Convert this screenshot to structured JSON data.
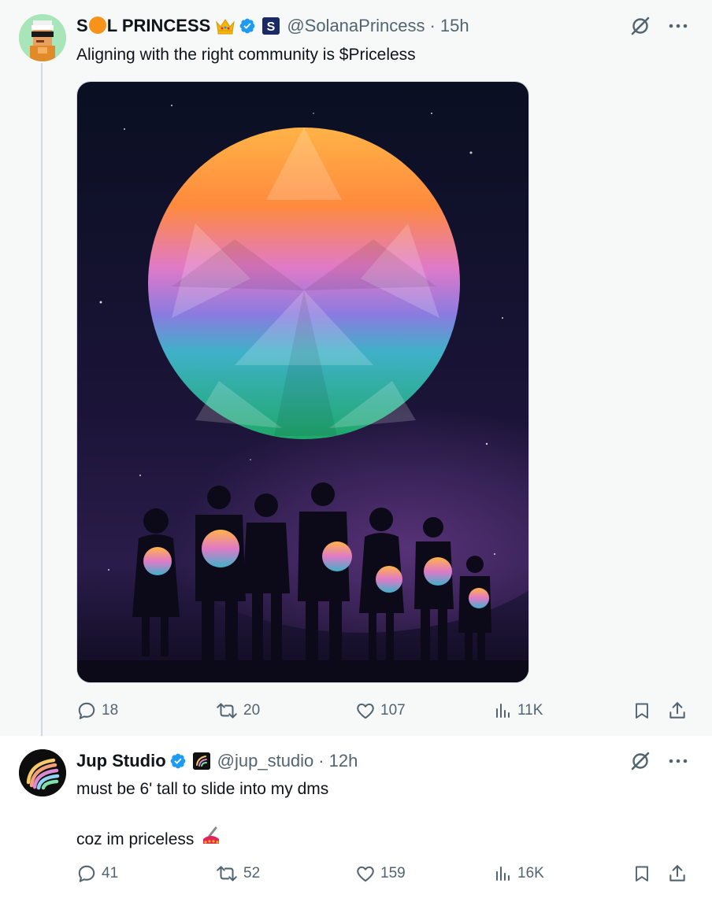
{
  "tweets": [
    {
      "display_name_prefix": "S",
      "display_name_suffix": "L PRINCESS",
      "handle": "@SolanaPrincess",
      "separator": "·",
      "time": "15h",
      "text": "Aligning with the right community is $Priceless",
      "stats": {
        "replies": "18",
        "reposts": "20",
        "likes": "107",
        "views": "11K"
      },
      "icons": {
        "verified": "verified-badge-icon",
        "affiliate": "solana-s-icon",
        "crown": "crown-icon",
        "grok": "grok-icon",
        "more": "more-icon"
      }
    },
    {
      "display_name": "Jup Studio",
      "handle": "@jup_studio",
      "separator": "·",
      "time": "12h",
      "text_line1": "must be 6' tall to slide into my dms",
      "text_line3": "coz im priceless",
      "stats": {
        "replies": "41",
        "reposts": "52",
        "likes": "159",
        "views": "16K"
      },
      "icons": {
        "verified": "verified-badge-icon",
        "affiliate": "jup-logo-icon",
        "emoji": "nail-polish-icon"
      }
    }
  ],
  "colors": {
    "verified": "#1d9bf0",
    "muted": "#536471",
    "text": "#0f1419",
    "thread_line": "#cfd9de",
    "highlight_bg": "#f7f9f9"
  }
}
